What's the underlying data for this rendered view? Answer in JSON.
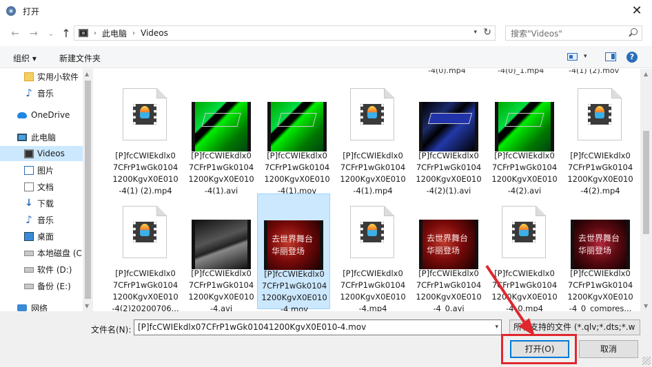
{
  "window": {
    "title": "打开",
    "close_glyph": "✕"
  },
  "nav": {
    "back_glyph": "←",
    "forward_glyph": "→",
    "recent_glyph": "⌄",
    "up_glyph": "↑",
    "breadcrumb": [
      "此电脑",
      "Videos"
    ],
    "separator": "›",
    "refresh_glyph": "↻",
    "dropdown_glyph": "▾"
  },
  "search": {
    "placeholder": "搜索\"Videos\""
  },
  "toolbar": {
    "organize_label": "组织 ▾",
    "new_folder_label": "新建文件夹",
    "view_dropdown_glyph": "▾",
    "help_glyph": "?"
  },
  "sidebar": {
    "items": [
      {
        "label": "实用小软件",
        "icon": "folder-icon"
      },
      {
        "label": "音乐",
        "icon": "music-icon"
      },
      {
        "label": "OneDrive",
        "icon": "cloud-icon"
      },
      {
        "label": "此电脑",
        "icon": "computer-icon"
      },
      {
        "label": "Videos",
        "icon": "video-folder-icon",
        "selected": true
      },
      {
        "label": "图片",
        "icon": "pictures-icon"
      },
      {
        "label": "文档",
        "icon": "documents-icon"
      },
      {
        "label": "下载",
        "icon": "download-icon"
      },
      {
        "label": "音乐",
        "icon": "music-icon"
      },
      {
        "label": "桌面",
        "icon": "desktop-icon"
      },
      {
        "label": "本地磁盘 (C",
        "icon": "drive-icon"
      },
      {
        "label": "软件 (D:)",
        "icon": "drive-icon"
      },
      {
        "label": "备份 (E:)",
        "icon": "drive-icon"
      },
      {
        "label": "网络",
        "icon": "network-icon"
      }
    ]
  },
  "files": {
    "top_partial": [
      "-4(0).mp4",
      "-4(0)_1.mp4",
      "-4(1) (2).mov"
    ],
    "row1": [
      {
        "label": "[P]fcCWIEkdlx0\n7CFrP1wGk0104\n1200KgvX0E010\n-4(1) (2).mp4",
        "thumb": "generic"
      },
      {
        "label": "[P]fcCWIEkdlx0\n7CFrP1wGk0104\n1200KgvX0E010\n-4(1).avi",
        "thumb": "green"
      },
      {
        "label": "[P]fcCWIEkdlx0\n7CFrP1wGk0104\n1200KgvX0E010\n-4(1).mov",
        "thumb": "green"
      },
      {
        "label": "[P]fcCWIEkdlx0\n7CFrP1wGk0104\n1200KgvX0E010\n-4(1).mp4",
        "thumb": "generic"
      },
      {
        "label": "[P]fcCWIEkdlx0\n7CFrP1wGk0104\n1200KgvX0E010\n-4(2)(1).avi",
        "thumb": "blue"
      },
      {
        "label": "[P]fcCWIEkdlx0\n7CFrP1wGk0104\n1200KgvX0E010\n-4(2).avi",
        "thumb": "green"
      },
      {
        "label": "[P]fcCWIEkdlx0\n7CFrP1wGk0104\n1200KgvX0E010\n-4(2).mp4",
        "thumb": "generic"
      }
    ],
    "row2": [
      {
        "label": "[P]fcCWIEkdlx0\n7CFrP1wGk0104\n1200KgvX0E010\n-4(2)20200706...",
        "thumb": "generic"
      },
      {
        "label": "[P]fcCWIEkdlx0\n7CFrP1wGk0104\n1200KgvX0E010\n-4.avi",
        "thumb": "dark"
      },
      {
        "label": "[P]fcCWIEkdlx0\n7CFrP1wGk0104\n1200KgvX0E010\n-4.mov",
        "thumb": "red",
        "selected": true
      },
      {
        "label": "[P]fcCWIEkdlx0\n7CFrP1wGk0104\n1200KgvX0E010\n-4.mp4",
        "thumb": "generic"
      },
      {
        "label": "[P]fcCWIEkdlx0\n7CFrP1wGk0104\n1200KgvX0E010\n-4_0.avi",
        "thumb": "red"
      },
      {
        "label": "[P]fcCWIEkdlx0\n7CFrP1wGk0104\n1200KgvX0E010\n-4_0.mp4",
        "thumb": "generic"
      },
      {
        "label": "[P]fcCWIEkdlx0\n7CFrP1wGk0104\n1200KgvX0E010\n-4_0_compres...",
        "thumb": "red2"
      }
    ]
  },
  "footer": {
    "filename_label": "文件名(N):",
    "filename_value": "[P]fcCWIEkdlx07CFrP1wGk01041200KgvX0E010-4.mov",
    "filetype_value": "所有支持的文件 (*.qlv;*.dts;*.w",
    "open_label": "打开(O)",
    "cancel_label": "取消",
    "accent_color": "#0078d7",
    "highlight_color": "#e0272d"
  }
}
